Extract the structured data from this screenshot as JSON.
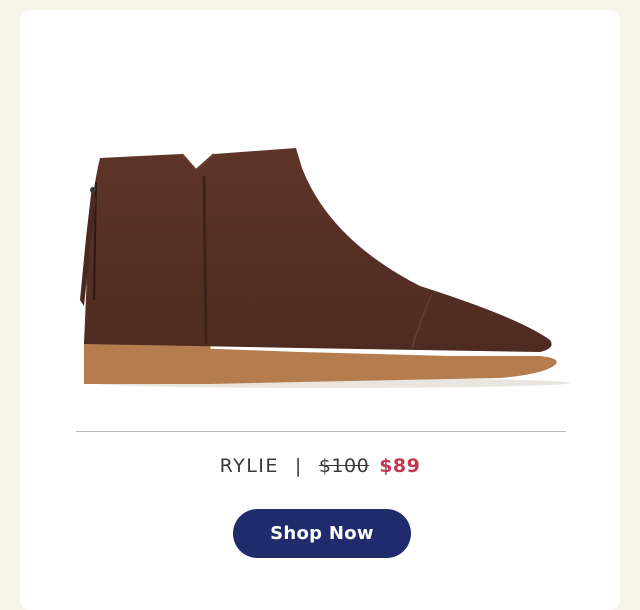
{
  "product": {
    "name": "RYLIE",
    "separator": "|",
    "original_price": "$100",
    "sale_price": "$89",
    "image_icon": "ankle-boot-image"
  },
  "cta": {
    "label": "Shop Now"
  },
  "colors": {
    "background": "#f7f4ea",
    "card": "#ffffff",
    "button": "#1f2b6c",
    "sale_price": "#c0394e",
    "boot_suede": "#5a3226",
    "boot_sole": "#b07a4c"
  }
}
